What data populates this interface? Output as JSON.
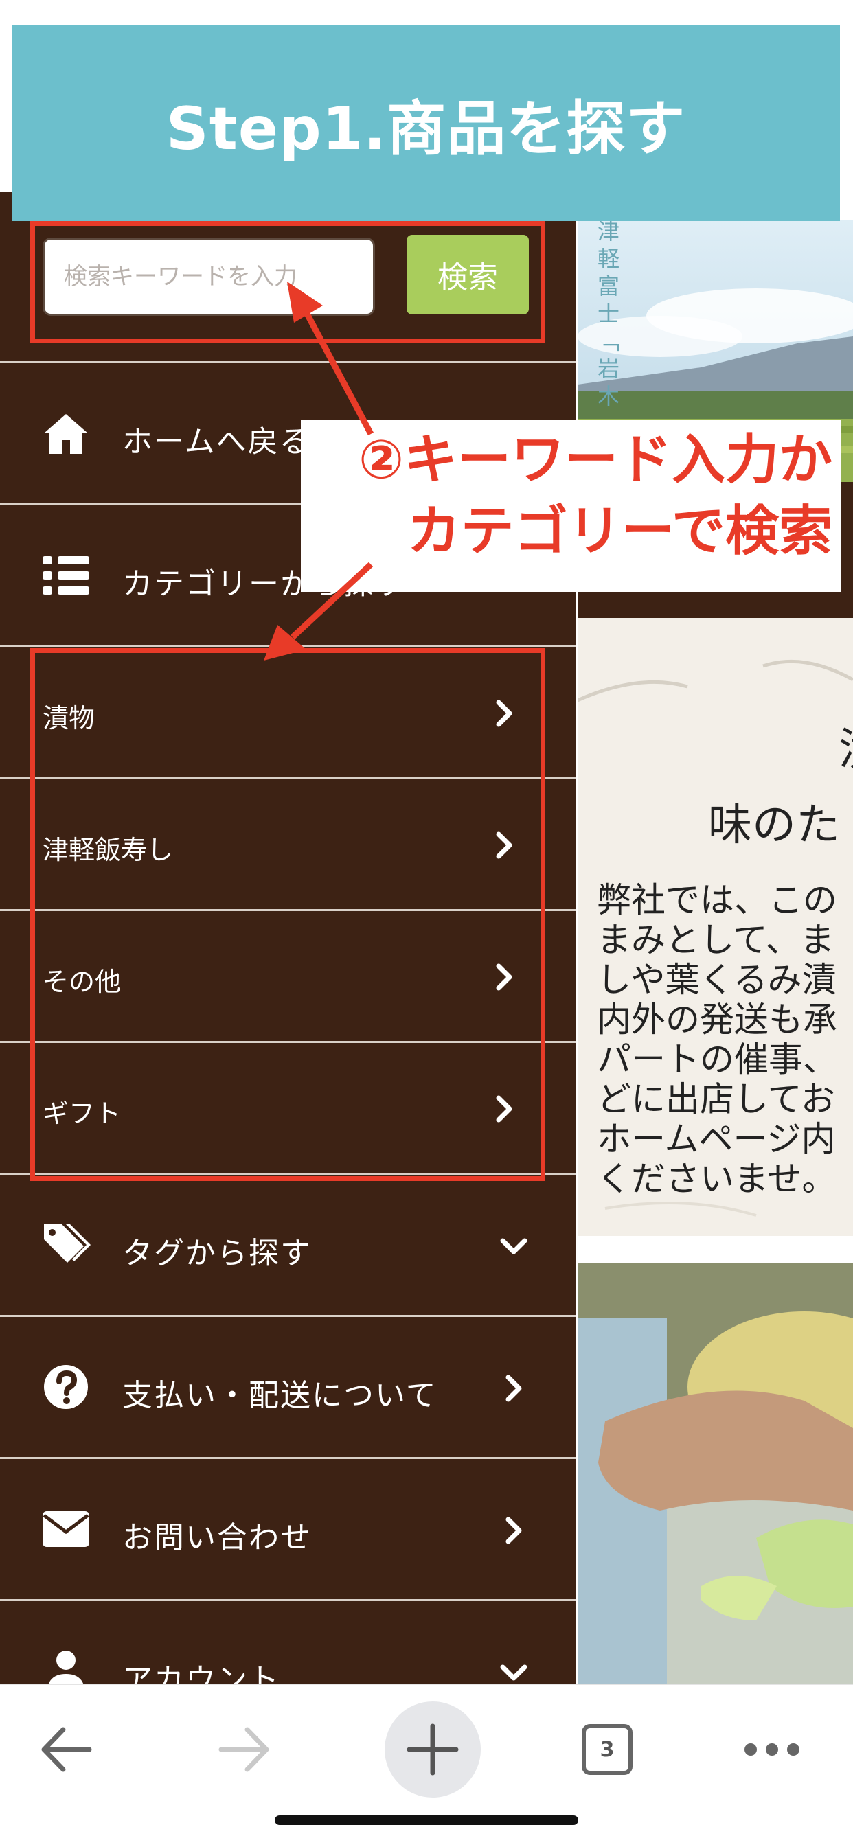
{
  "banner": {
    "title": "Step1.商品を探す"
  },
  "search": {
    "placeholder": "検索キーワードを入力",
    "button_label": "検索"
  },
  "menu": {
    "home_label": "ホームへ戻る",
    "category_label": "カテゴリーから探す",
    "categories": [
      "漬物",
      "津軽飯寿し",
      "その他",
      "ギフト"
    ],
    "tag_label": "タグから探す",
    "payment_label": "支払い・配送について",
    "contact_label": "お問い合わせ",
    "account_label": "アカウント"
  },
  "annotation": {
    "line1": "②キーワード入力か",
    "line2": "カテゴリーで検索"
  },
  "right_content": {
    "photo_caption": "津軽富士「岩木",
    "heading1": "漬",
    "heading2": "味のた",
    "body_lines": [
      "弊社では、この",
      "まみとして、ま",
      "しや葉くるみ漬",
      "内外の発送も承",
      "パートの催事、",
      "どに出店してお",
      "ホームページ内",
      "くださいませ。"
    ]
  },
  "toolbar": {
    "tab_count": "3"
  },
  "colors": {
    "banner": "#6cbfcc",
    "sidebar": "#3d2214",
    "accent_red": "#e83b28",
    "search_button": "#a9cd5c"
  }
}
